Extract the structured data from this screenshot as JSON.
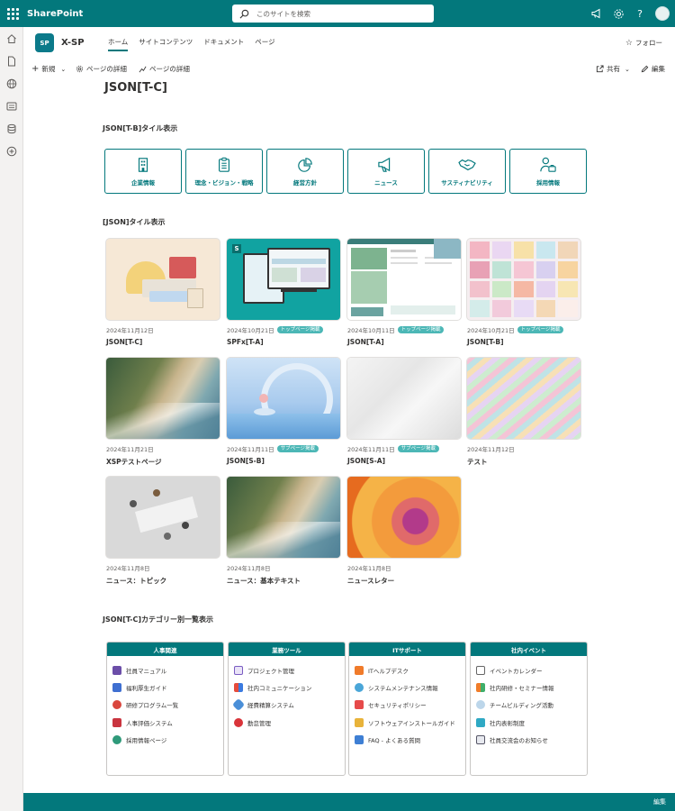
{
  "suite": {
    "app_name": "SharePoint",
    "search_placeholder": "このサイトを検索"
  },
  "site": {
    "name": "X-SP",
    "logo_text": "SP",
    "nav": [
      "ホーム",
      "サイトコンテンツ",
      "ドキュメント",
      "ページ"
    ],
    "follow_label": "フォロー"
  },
  "command_bar": {
    "new_label": "新規",
    "page_details_1": "ページの詳細",
    "page_details_2": "ページの詳細",
    "share_label": "共有",
    "edit_label": "編集"
  },
  "page": {
    "title": "JSON[T-C]"
  },
  "section_tiles": {
    "title": "JSON[T-B]タイル表示",
    "tiles": [
      {
        "label": "企業情報",
        "icon": "building-icon"
      },
      {
        "label": "理念・ビジョン・戦略",
        "icon": "clipboard-icon"
      },
      {
        "label": "経営方針",
        "icon": "pie-chart-icon"
      },
      {
        "label": "ニュース",
        "icon": "megaphone-icon"
      },
      {
        "label": "サスティナビリティ",
        "icon": "handshake-icon"
      },
      {
        "label": "採用情報",
        "icon": "person-briefcase-icon"
      }
    ]
  },
  "section_news": {
    "title": "[JSON]タイル表示",
    "cards": [
      {
        "date": "2024年11月12日",
        "badge": "",
        "title": "JSON[T-C]"
      },
      {
        "date": "2024年10月21日",
        "badge": "トップページ掲載",
        "title": "SPFx[T-A]"
      },
      {
        "date": "2024年10月11日",
        "badge": "トップページ掲載",
        "title": "JSON[T-A]"
      },
      {
        "date": "2024年10月21日",
        "badge": "トップページ掲載",
        "title": "JSON[T-B]"
      },
      {
        "date": "2024年11月21日",
        "badge": "",
        "title": "XSPテストページ"
      },
      {
        "date": "2024年11月11日",
        "badge": "サブページ掲載",
        "title": "JSON[S-B]"
      },
      {
        "date": "2024年11月11日",
        "badge": "サブページ掲載",
        "title": "JSON[S-A]"
      },
      {
        "date": "2024年11月12日",
        "badge": "",
        "title": "テスト"
      },
      {
        "date": "2024年11月8日",
        "badge": "",
        "title": "ニュース：トピック"
      },
      {
        "date": "2024年11月8日",
        "badge": "",
        "title": "ニュース：基本テキスト"
      },
      {
        "date": "2024年11月8日",
        "badge": "",
        "title": "ニュースレター"
      }
    ]
  },
  "section_categories": {
    "title": "JSON[T-C]カテゴリー別一覧表示",
    "columns": [
      {
        "header": "人事関連",
        "items": [
          "社員マニュアル",
          "福利厚生ガイド",
          "研修プログラム一覧",
          "人事評価システム",
          "採用情報ページ"
        ]
      },
      {
        "header": "業務ツール",
        "items": [
          "プロジェクト管理",
          "社内コミュニケーション",
          "経費精算システム",
          "勤怠管理"
        ]
      },
      {
        "header": "ITサポート",
        "items": [
          "ITヘルプデスク",
          "システムメンテナンス情報",
          "セキュリティポリシー",
          "ソフトウェアインストールガイド",
          "FAQ - よくある質問"
        ]
      },
      {
        "header": "社内イベント",
        "items": [
          "イベントカレンダー",
          "社内研修・セミナー情報",
          "チームビルディング活動",
          "社内表彰制度",
          "社員交流会のお知らせ"
        ]
      }
    ]
  },
  "footer": {
    "edit_label": "編集"
  },
  "colors": {
    "brand": "#03787c",
    "badge": "#4cb7b6"
  }
}
